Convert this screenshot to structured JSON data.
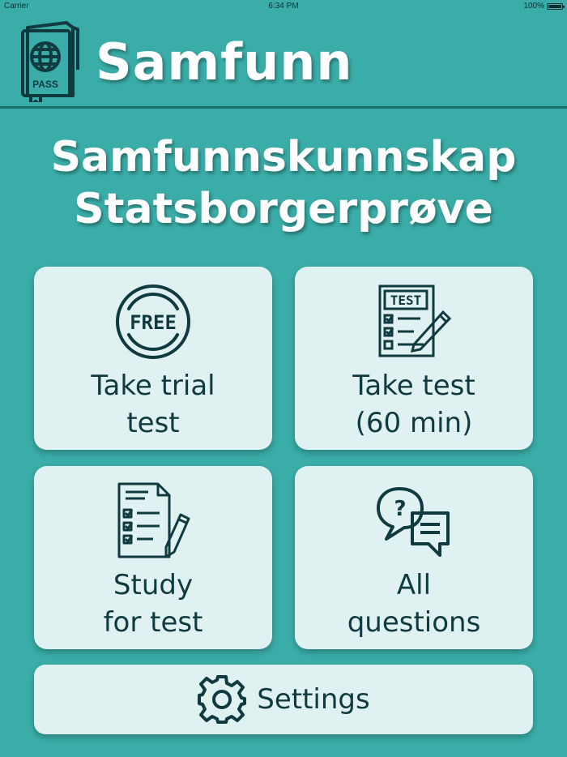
{
  "status_bar": {
    "carrier": "Carrier",
    "time": "6:34 PM",
    "battery": "100%"
  },
  "header": {
    "title": "Samfunn",
    "logo_text": "PASS"
  },
  "headline": {
    "line1": "Samfunnskunnskap",
    "line2": "Statsborgerprøve"
  },
  "menu": {
    "trial": {
      "line1": "Take trial",
      "line2": "test",
      "icon_text": "FREE"
    },
    "test": {
      "line1": "Take test",
      "line2": "(60 min)",
      "icon_text": "TEST"
    },
    "study": {
      "line1": "Study",
      "line2": "for test"
    },
    "questions": {
      "line1": "All",
      "line2": "questions",
      "icon_text": "?"
    }
  },
  "settings": {
    "label": "Settings"
  },
  "colors": {
    "background": "#3aada8",
    "card": "#dff2f1",
    "ink": "#0f3a40",
    "title": "#ffffff"
  }
}
